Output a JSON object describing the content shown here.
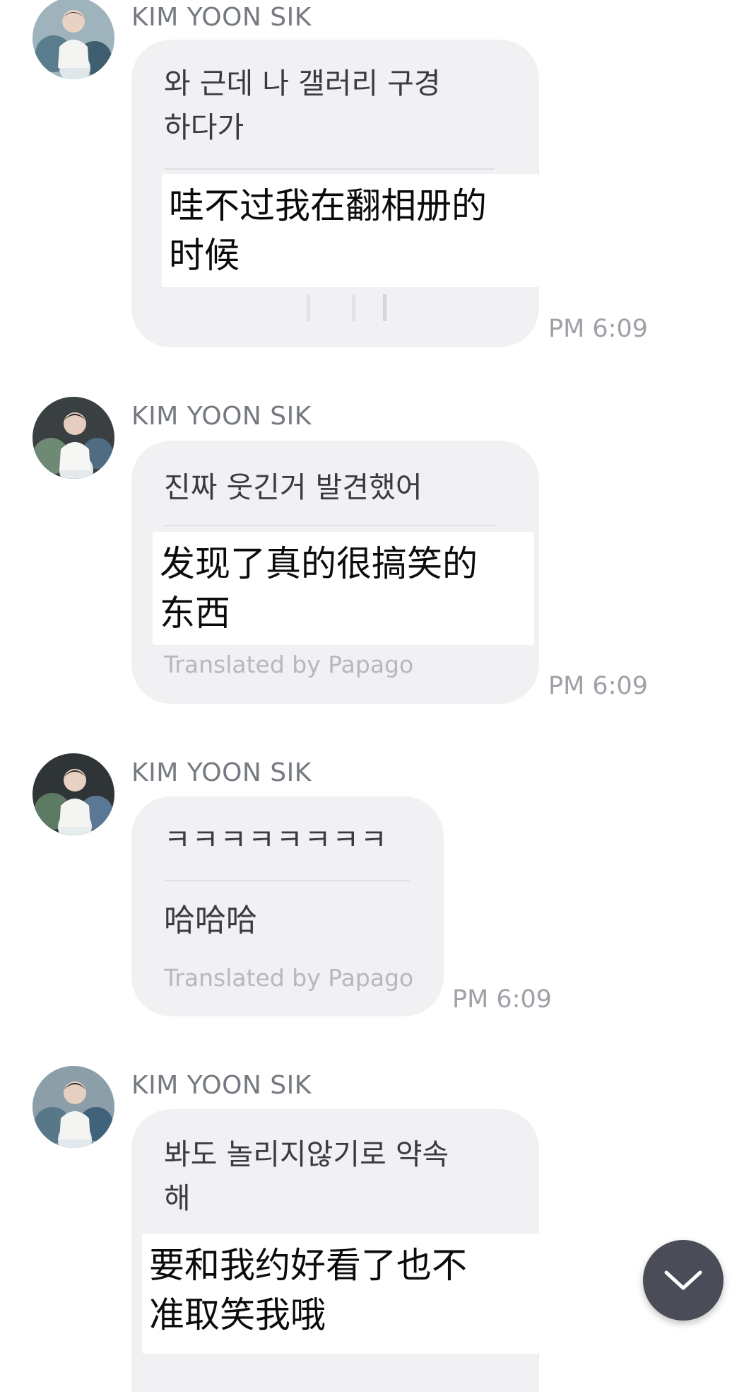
{
  "messages": [
    {
      "sender": "KIM YOON SIK",
      "original": "와 근데 나 갤러리 구경\n하다가",
      "translation": "哇不过我在翻相册的\n时候",
      "time": "PM 6:09"
    },
    {
      "sender": "KIM YOON SIK",
      "original": "진짜 웃긴거 발견했어",
      "translation": "发现了真的很搞笑的\n东西",
      "footer": "Translated by Papago",
      "time": "PM 6:09"
    },
    {
      "sender": "KIM YOON SIK",
      "original": "ㅋㅋㅋㅋㅋㅋㅋㅋ",
      "translation": "哈哈哈",
      "footer": "Translated by Papago",
      "time": "PM 6:09"
    },
    {
      "sender": "KIM YOON SIK",
      "original": "봐도 놀리지않기로 약속\n해",
      "translation": "要和我约好看了也不\n准取笑我哦"
    }
  ],
  "scroll_button": {
    "icon": "chevron-down-icon"
  }
}
